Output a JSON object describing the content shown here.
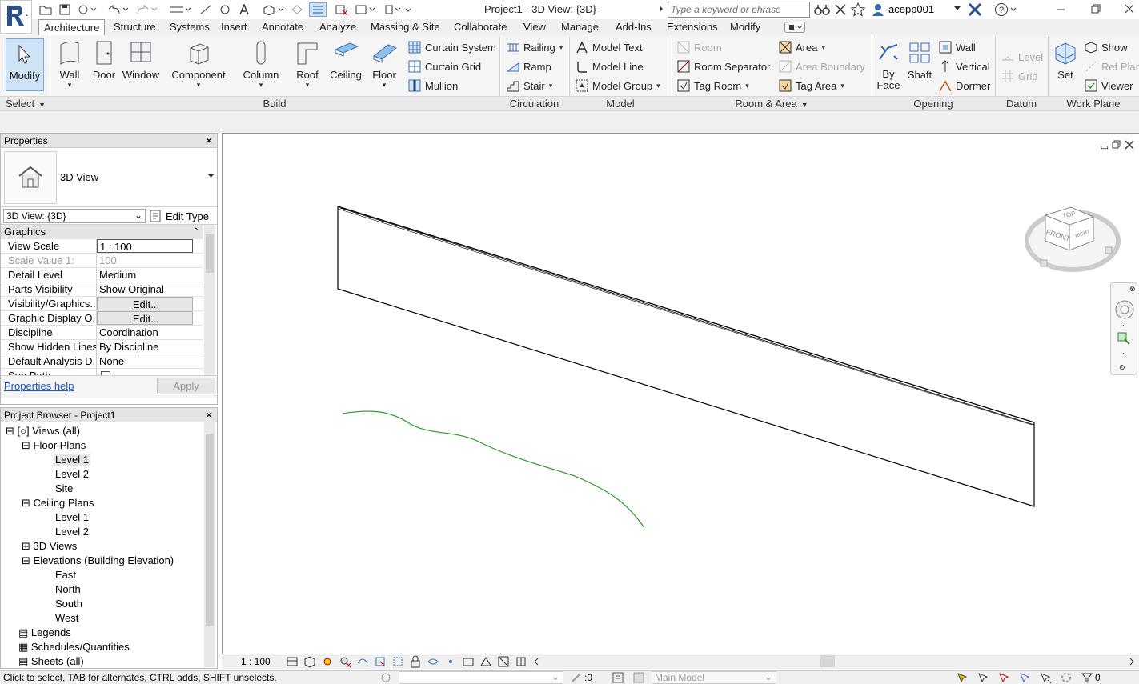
{
  "window": {
    "title": "Project1 - 3D View: {3D}"
  },
  "search": {
    "placeholder": "Type a keyword or phrase"
  },
  "user": {
    "name": "acepp001"
  },
  "tabs": [
    "Architecture",
    "Structure",
    "Systems",
    "Insert",
    "Annotate",
    "Analyze",
    "Massing & Site",
    "Collaborate",
    "View",
    "Manage",
    "Add-Ins",
    "Extensions",
    "Modify"
  ],
  "ribbon": {
    "select": {
      "modify": "Modify",
      "select_label": "Select"
    },
    "build": {
      "label": "Build",
      "wall": "Wall",
      "door": "Door",
      "window": "Window",
      "component": "Component",
      "column": "Column",
      "roof": "Roof",
      "ceiling": "Ceiling",
      "floor": "Floor",
      "curtain_system": "Curtain System",
      "curtain_grid": "Curtain Grid",
      "mullion": "Mullion"
    },
    "circulation": {
      "label": "Circulation",
      "railing": "Railing",
      "ramp": "Ramp",
      "stair": "Stair"
    },
    "model": {
      "label": "Model",
      "model_text": "Model Text",
      "model_line": "Model Line",
      "model_group": "Model Group"
    },
    "room_area": {
      "label": "Room & Area",
      "room": "Room",
      "room_separator": "Room Separator",
      "tag_room": "Tag Room",
      "area": "Area",
      "area_boundary": "Area Boundary",
      "tag_area": "Tag Area"
    },
    "opening": {
      "label": "Opening",
      "by_face_1": "By",
      "by_face_2": "Face",
      "shaft": "Shaft",
      "wall": "Wall",
      "vertical": "Vertical",
      "dormer": "Dormer"
    },
    "datum": {
      "label": "Datum",
      "level": "Level",
      "grid": "Grid"
    },
    "work_plane": {
      "label": "Work Plane",
      "set": "Set",
      "show": "Show",
      "ref_plane": "Ref Plan",
      "viewer": "Viewer"
    }
  },
  "properties": {
    "title": "Properties",
    "type_name": "3D View",
    "instance_selector": "3D View: {3D}",
    "edit_type": "Edit Type",
    "section": "Graphics",
    "rows": [
      {
        "k": "View Scale",
        "v": "1 : 100"
      },
      {
        "k": "Scale Value    1:",
        "v": "100"
      },
      {
        "k": "Detail Level",
        "v": "Medium"
      },
      {
        "k": "Parts Visibility",
        "v": "Show Original"
      },
      {
        "k": "Visibility/Graphics...",
        "v": "Edit..."
      },
      {
        "k": "Graphic Display O...",
        "v": "Edit..."
      },
      {
        "k": "Discipline",
        "v": "Coordination"
      },
      {
        "k": "Show Hidden Lines",
        "v": "By Discipline"
      },
      {
        "k": "Default Analysis D...",
        "v": "None"
      },
      {
        "k": "Sun Path",
        "v": ""
      }
    ],
    "help": "Properties help",
    "apply": "Apply"
  },
  "browser": {
    "title": "Project Browser - Project1",
    "views_all": "Views (all)",
    "floor_plans": "Floor Plans",
    "fp_level1": "Level 1",
    "fp_level2": "Level 2",
    "fp_site": "Site",
    "ceiling_plans": "Ceiling Plans",
    "cp_level1": "Level 1",
    "cp_level2": "Level 2",
    "views_3d": "3D Views",
    "elevations": "Elevations (Building Elevation)",
    "east": "East",
    "north": "North",
    "south": "South",
    "west": "West",
    "legends": "Legends",
    "schedules": "Schedules/Quantities",
    "sheets": "Sheets (all)"
  },
  "viewcube": {
    "top": "TOP",
    "front": "FRONT",
    "right": "RIGHT"
  },
  "view_bar": {
    "scale": "1 : 100"
  },
  "status": {
    "message": "Click to select, TAB for alternates, CTRL adds, SHIFT unselects.",
    "filter_count": ":0",
    "model": "Main Model",
    "selection_count": "0"
  }
}
